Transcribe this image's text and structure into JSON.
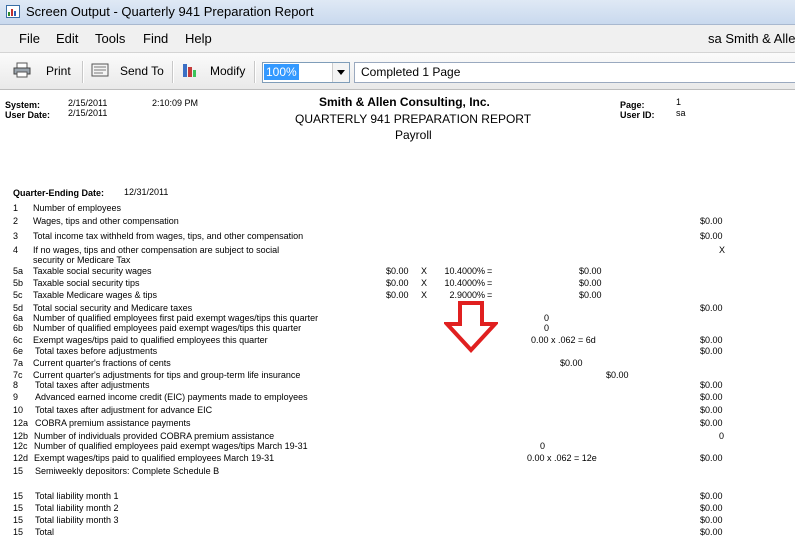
{
  "window": {
    "title": "Screen Output - Quarterly 941 Preparation Report"
  },
  "menu": {
    "file": "File",
    "edit": "Edit",
    "tools": "Tools",
    "find": "Find",
    "help": "Help",
    "user": "sa   Smith & Allen"
  },
  "toolbar": {
    "print": "Print",
    "send_to": "Send To",
    "modify": "Modify",
    "zoom": "100%",
    "status": "Completed 1 Page"
  },
  "report": {
    "header": {
      "system_label": "System:",
      "system_date": "2/15/2011",
      "system_time": "2:10:09 PM",
      "user_date_label": "User Date:",
      "user_date": "2/15/2011",
      "company": "Smith & Allen Consulting, Inc.",
      "report_title": "QUARTERLY 941 PREPARATION REPORT",
      "subtitle": "Payroll",
      "page_label": "Page:",
      "page": "1",
      "user_id_label": "User ID:",
      "user_id": "sa"
    },
    "quarter_label": "Quarter-Ending Date:",
    "quarter_date": "12/31/2011",
    "lines": [
      {
        "num": "1",
        "desc": "Number of employees",
        "amt": ""
      },
      {
        "num": "2",
        "desc": "Wages, tips and other compensation",
        "amt": "$0.00"
      },
      {
        "num": "3",
        "desc": "Total income tax withheld from wages, tips, and other compensation",
        "amt": "$0.00"
      },
      {
        "num": "4",
        "desc": "If no wages, tips and other compensation are subject to social",
        "amt": "X"
      },
      {
        "num": "",
        "desc": "security or Medicare Tax",
        "amt": ""
      },
      {
        "num": "5a",
        "desc": "Taxable social security wages",
        "c1": "$0.00",
        "x": "X",
        "rate": "10.4000%",
        "eq": "=",
        "c2": "$0.00",
        "amt": ""
      },
      {
        "num": "5b",
        "desc": "Taxable social security tips",
        "c1": "$0.00",
        "x": "X",
        "rate": "10.4000%",
        "eq": "=",
        "c2": "$0.00",
        "amt": ""
      },
      {
        "num": "5c",
        "desc": "Taxable Medicare wages & tips",
        "c1": "$0.00",
        "x": "X",
        "rate": "2.9000%",
        "eq": "=",
        "c2": "$0.00",
        "amt": ""
      },
      {
        "num": "5d",
        "desc": "Total social security and Medicare taxes",
        "amt": "$0.00"
      },
      {
        "num": "6a",
        "desc": "Number of qualified employees first paid exempt wages/tips this quarter",
        "mid": "0",
        "amt": ""
      },
      {
        "num": "6b",
        "desc": "Number of qualified employees paid exempt wages/tips this quarter",
        "mid": "0",
        "amt": ""
      },
      {
        "num": "6c",
        "desc": "Exempt wages/tips paid to qualified employees this quarter",
        "calc": "0.00  x .062 =     6d",
        "amt": "$0.00"
      },
      {
        "num": "6e",
        "desc": "Total taxes before adjustments",
        "amt": "$0.00"
      },
      {
        "num": "7a",
        "desc": "Current quarter's fractions of cents",
        "c2": "$0.00",
        "amt": ""
      },
      {
        "num": "7c",
        "desc": "Current quarter's adjustments for tips and group-term life insurance",
        "c3": "$0.00",
        "amt": ""
      },
      {
        "num": "8",
        "desc": "Total taxes after adjustments",
        "amt": "$0.00"
      },
      {
        "num": "9",
        "desc": "Advanced earned income credit (EIC) payments made to employees",
        "amt": "$0.00"
      },
      {
        "num": "10",
        "desc": "Total taxes after adjustment for advance EIC",
        "amt": "$0.00"
      },
      {
        "num": "12a",
        "desc": "COBRA premium assistance payments",
        "amt": "$0.00"
      },
      {
        "num": "12b",
        "desc": "Number of individuals provided COBRA premium assistance",
        "amt": "0"
      },
      {
        "num": "12c",
        "desc": "Number of qualified employees paid exempt  wages/tips March 19-31",
        "mid": "0",
        "amt": ""
      },
      {
        "num": "12d",
        "desc": "Exempt wages/tips paid to qualified employees March 19-31",
        "calc": "0.00 x .062 =     12e",
        "amt": "$0.00"
      },
      {
        "num": "15",
        "desc": "Semiweekly depositors: Complete Schedule B",
        "amt": ""
      },
      {
        "num": "15",
        "desc": "Total liability month 1",
        "amt": "$0.00"
      },
      {
        "num": "15",
        "desc": "Total liability month 2",
        "amt": "$0.00"
      },
      {
        "num": "15",
        "desc": "Total liability month 3",
        "amt": "$0.00"
      },
      {
        "num": "15",
        "desc": "Total",
        "amt": "$0.00"
      }
    ]
  },
  "colors": {
    "annotation_arrow": "#e02020",
    "zoom_highlight": "#3399ff"
  },
  "icons": {
    "app": "report-icon",
    "print": "printer-icon",
    "send": "send-icon",
    "modify": "modify-icon"
  }
}
